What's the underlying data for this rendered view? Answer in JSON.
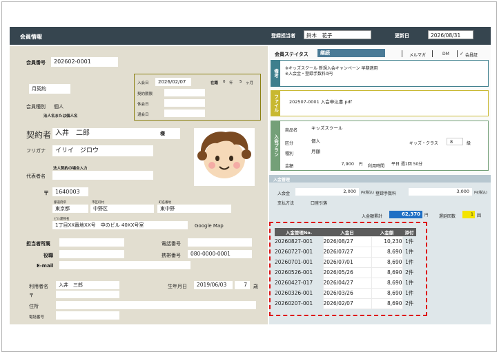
{
  "header": {
    "title": "会員情報",
    "staff_label": "登録担当者",
    "staff_value": "鈴木　花子",
    "updated_label": "更新日",
    "updated_value": "2026/08/31"
  },
  "member": {
    "number_label": "会員番号",
    "number_value": "202602-0001",
    "contract_value": "月契約",
    "type_label": "会員種別",
    "type_value": "個人",
    "corp_note": "法人名または個人名",
    "contractor_label": "契約者",
    "contractor_value": "入井　二郎",
    "honorific": "様",
    "furigana_label": "フリガナ",
    "furigana_value": "イリイ　ジロウ",
    "corp_only_note": "法人契約の場合入力",
    "rep_label": "代表者名",
    "postal_mark": "〒",
    "postal_value": "1640003",
    "pref_label": "都道府県",
    "pref_value": "東京都",
    "city_label": "市区町村",
    "city_value": "中野区",
    "town_label": "町名番地",
    "town_value": "東中野",
    "bldg_label": "ビル建物名",
    "bldg_value": "1丁目XX番地XX号　中のビル 40XX号室",
    "map_link": "Google Map",
    "dept_label": "担当者所属",
    "title_label": "役職",
    "email_label": "E-mail",
    "phone_label": "電話番号",
    "mobile_label": "携帯番号",
    "mobile_value": "080-0000-0001",
    "user_label": "利用者名",
    "user_value": "入井　三郎",
    "birth_label": "生年月日",
    "birth_value": "2019/06/03",
    "age_value": "7",
    "age_unit": "歳",
    "user_postal_mark": "〒",
    "addr_label": "住所",
    "user_phone_label": "電話番号"
  },
  "enroll_box": {
    "join_label": "入会日",
    "join_value": "2026/02/07",
    "tenure_label": "在籍",
    "tenure_years": "0",
    "years_unit": "年",
    "tenure_months": "5",
    "months_unit": "ヶ月",
    "term_label": "契約期限",
    "pause_label": "休会日",
    "leave_label": "退会日"
  },
  "status": {
    "label": "会員ステイタス",
    "value": "継続",
    "mailmag": "メルマガ",
    "dm": "DM",
    "card": "会員証",
    "card_check": "✓"
  },
  "memo": {
    "tab": "備考",
    "line1": "※キッズスクール 新規入会キャンペーン 早期適用",
    "line2": "※入会金・登録手数料0円"
  },
  "file": {
    "tab": "ファイル",
    "name": "202507-0001 入会申込書.pdf"
  },
  "plan": {
    "tab": "入会プラン",
    "product_label": "商品名",
    "product_value": "キッズスクール",
    "category_label": "区分",
    "category_value": "個人",
    "class_label": "キッズ・クラス",
    "class_value": "8",
    "class_unit": "級",
    "kind_label": "種別",
    "kind_value": "月額",
    "price_label": "金額",
    "price_value": "7,900",
    "price_unit": "円",
    "time_label": "利用時間",
    "time_value": "平日 週1回 50分"
  },
  "payment": {
    "section_title": "入金管理",
    "entry_fee_label": "入会金",
    "entry_fee_value": "2,000",
    "reg_fee_label": "登録手数料",
    "reg_fee_value": "3,000",
    "unit_tax": "円(税込)",
    "method_label": "支払方法",
    "method_value": "口座引落",
    "total_label": "入金額累計",
    "total_value": "62,370",
    "total_unit": "円",
    "late_label": "遅延回数",
    "late_value": "1",
    "late_unit": "回",
    "columns": [
      "入金管理No.",
      "入金日",
      "入金額",
      "添付"
    ],
    "rows": [
      [
        "20260827-001",
        "2026/08/27",
        "10,230",
        "1件"
      ],
      [
        "20260727-001",
        "2026/07/27",
        "8,690",
        "1件"
      ],
      [
        "20260701-001",
        "2026/07/01",
        "8,690",
        "1件"
      ],
      [
        "20260526-001",
        "2026/05/26",
        "8,690",
        "2件"
      ],
      [
        "20260427-017",
        "2026/04/27",
        "8,690",
        "1件"
      ],
      [
        "20260326-001",
        "2026/03/26",
        "8,690",
        "1件"
      ],
      [
        "20260207-001",
        "2026/02/07",
        "8,690",
        "2件"
      ]
    ]
  },
  "colors": {
    "header_bg": "#36454f",
    "left_bg": "#e2ded0",
    "status_badge": "#4a7a96",
    "memo_border": "#3e7f8d",
    "file_border": "#c8b830",
    "plan_border": "#74a078",
    "payment_header": "#b7c7d0",
    "total_bg": "#1f6fc4",
    "late_bg": "#f4e400",
    "highlight_dashed": "#dd1111"
  },
  "icons": {
    "avatar": "child-face-illustration",
    "check": "checkmark-icon"
  }
}
